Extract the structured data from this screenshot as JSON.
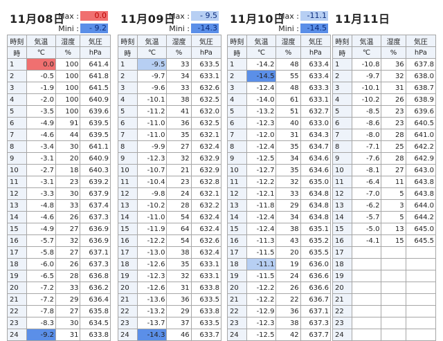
{
  "headers": {
    "row1": [
      "時刻",
      "気温",
      "湿度",
      "気圧"
    ],
    "row2": [
      "時",
      "℃",
      "%",
      "hPa"
    ]
  },
  "days": [
    {
      "date": "11月08日",
      "max_label": "Max :",
      "max": "0.0",
      "min_label": "Mini :",
      "min": "- 9.2",
      "rows": [
        [
          "1",
          "0.0",
          "100",
          "641.4"
        ],
        [
          "2",
          "-0.5",
          "100",
          "641.8"
        ],
        [
          "3",
          "-1.9",
          "100",
          "641.5"
        ],
        [
          "4",
          "-2.0",
          "100",
          "640.9"
        ],
        [
          "5",
          "-3.5",
          "100",
          "639.6"
        ],
        [
          "6",
          "-4.9",
          "91",
          "639.5"
        ],
        [
          "7",
          "-4.6",
          "44",
          "639.5"
        ],
        [
          "8",
          "-3.4",
          "30",
          "641.1"
        ],
        [
          "9",
          "-3.1",
          "20",
          "640.9"
        ],
        [
          "10",
          "-2.7",
          "18",
          "640.3"
        ],
        [
          "11",
          "-3.1",
          "23",
          "639.2"
        ],
        [
          "12",
          "-3.3",
          "30",
          "637.9"
        ],
        [
          "13",
          "-4.8",
          "33",
          "637.4"
        ],
        [
          "14",
          "-4.6",
          "26",
          "637.3"
        ],
        [
          "15",
          "-4.9",
          "27",
          "636.9"
        ],
        [
          "16",
          "-5.7",
          "32",
          "636.9"
        ],
        [
          "17",
          "-5.8",
          "27",
          "637.1"
        ],
        [
          "18",
          "-6.0",
          "26",
          "637.3"
        ],
        [
          "19",
          "-6.5",
          "28",
          "636.8"
        ],
        [
          "20",
          "-7.2",
          "33",
          "636.2"
        ],
        [
          "21",
          "-7.2",
          "29",
          "636.4"
        ],
        [
          "22",
          "-7.8",
          "27",
          "635.8"
        ],
        [
          "23",
          "-8.3",
          "30",
          "634.5"
        ],
        [
          "24",
          "-9.2",
          "31",
          "633.8"
        ]
      ]
    },
    {
      "date": "11月09日",
      "max_label": "Max :",
      "max": "- 9.5",
      "min_label": "Mini :",
      "min": "-14.3",
      "rows": [
        [
          "1",
          "-9.5",
          "33",
          "633.5"
        ],
        [
          "2",
          "-9.7",
          "34",
          "633.1"
        ],
        [
          "3",
          "-9.6",
          "33",
          "632.6"
        ],
        [
          "4",
          "-10.1",
          "38",
          "632.5"
        ],
        [
          "5",
          "-11.2",
          "41",
          "632.0"
        ],
        [
          "6",
          "-11.0",
          "36",
          "632.5"
        ],
        [
          "7",
          "-11.0",
          "35",
          "632.1"
        ],
        [
          "8",
          "-9.9",
          "27",
          "632.4"
        ],
        [
          "9",
          "-12.3",
          "32",
          "632.9"
        ],
        [
          "10",
          "-10.7",
          "21",
          "632.9"
        ],
        [
          "11",
          "-10.4",
          "23",
          "632.8"
        ],
        [
          "12",
          "-9.8",
          "24",
          "632.1"
        ],
        [
          "13",
          "-10.2",
          "28",
          "632.2"
        ],
        [
          "14",
          "-11.0",
          "54",
          "632.4"
        ],
        [
          "15",
          "-11.9",
          "64",
          "632.4"
        ],
        [
          "16",
          "-12.2",
          "54",
          "632.6"
        ],
        [
          "17",
          "-13.0",
          "38",
          "632.4"
        ],
        [
          "18",
          "-12.6",
          "35",
          "633.1"
        ],
        [
          "19",
          "-12.3",
          "32",
          "633.1"
        ],
        [
          "20",
          "-12.6",
          "31",
          "633.8"
        ],
        [
          "21",
          "-13.6",
          "36",
          "633.5"
        ],
        [
          "22",
          "-13.2",
          "29",
          "633.8"
        ],
        [
          "23",
          "-13.7",
          "37",
          "633.5"
        ],
        [
          "24",
          "-14.3",
          "46",
          "633.7"
        ]
      ]
    },
    {
      "date": "11月10日",
      "max_label": "Max :",
      "max": "-11.1",
      "min_label": "Mini :",
      "min": "-14.5",
      "rows": [
        [
          "1",
          "-14.2",
          "48",
          "633.4"
        ],
        [
          "2",
          "-14.5",
          "55",
          "633.4"
        ],
        [
          "3",
          "-12.4",
          "48",
          "633.3"
        ],
        [
          "4",
          "-14.0",
          "61",
          "633.1"
        ],
        [
          "5",
          "-13.2",
          "51",
          "632.7"
        ],
        [
          "6",
          "-12.3",
          "40",
          "633.0"
        ],
        [
          "7",
          "-12.0",
          "31",
          "634.3"
        ],
        [
          "8",
          "-12.4",
          "35",
          "634.7"
        ],
        [
          "9",
          "-12.5",
          "34",
          "634.6"
        ],
        [
          "10",
          "-12.7",
          "35",
          "634.6"
        ],
        [
          "11",
          "-12.2",
          "32",
          "635.0"
        ],
        [
          "12",
          "-12.1",
          "33",
          "634.8"
        ],
        [
          "13",
          "-11.8",
          "29",
          "634.8"
        ],
        [
          "14",
          "-12.4",
          "34",
          "634.8"
        ],
        [
          "15",
          "-12.4",
          "38",
          "635.1"
        ],
        [
          "16",
          "-11.3",
          "43",
          "635.2"
        ],
        [
          "17",
          "-11.5",
          "20",
          "635.5"
        ],
        [
          "18",
          "-11.1",
          "19",
          "636.0"
        ],
        [
          "19",
          "-11.5",
          "24",
          "636.6"
        ],
        [
          "20",
          "-12.2",
          "26",
          "636.6"
        ],
        [
          "21",
          "-12.2",
          "22",
          "636.7"
        ],
        [
          "22",
          "-12.9",
          "36",
          "637.1"
        ],
        [
          "23",
          "-12.3",
          "38",
          "637.3"
        ],
        [
          "24",
          "-12.5",
          "42",
          "637.7"
        ]
      ]
    },
    {
      "date": "11月11日",
      "rows": [
        [
          "1",
          "-10.8",
          "36",
          "637.8"
        ],
        [
          "2",
          "-9.7",
          "32",
          "638.0"
        ],
        [
          "3",
          "-10.1",
          "31",
          "638.7"
        ],
        [
          "4",
          "-10.2",
          "26",
          "638.9"
        ],
        [
          "5",
          "-8.5",
          "23",
          "639.6"
        ],
        [
          "6",
          "-8.6",
          "23",
          "640.5"
        ],
        [
          "7",
          "-8.0",
          "28",
          "641.0"
        ],
        [
          "8",
          "-7.1",
          "25",
          "642.2"
        ],
        [
          "9",
          "-7.6",
          "28",
          "642.9"
        ],
        [
          "10",
          "-8.1",
          "27",
          "643.0"
        ],
        [
          "11",
          "-6.4",
          "11",
          "643.8"
        ],
        [
          "12",
          "-7.0",
          "5",
          "643.8"
        ],
        [
          "13",
          "-6.2",
          "3",
          "644.0"
        ],
        [
          "14",
          "-5.7",
          "5",
          "644.2"
        ],
        [
          "15",
          "-5.0",
          "13",
          "645.0"
        ],
        [
          "16",
          "-4.1",
          "15",
          "645.5"
        ],
        [
          "17",
          "",
          "",
          ""
        ],
        [
          "18",
          "",
          "",
          ""
        ],
        [
          "19",
          "",
          "",
          ""
        ],
        [
          "20",
          "",
          "",
          ""
        ],
        [
          "21",
          "",
          "",
          ""
        ],
        [
          "22",
          "",
          "",
          ""
        ],
        [
          "23",
          "",
          "",
          ""
        ],
        [
          "24",
          "",
          "",
          ""
        ]
      ]
    }
  ],
  "colors": {
    "max_highlight": "#f07070",
    "min_highlight": "#5b8fe8",
    "light_highlight": "#b7cff3",
    "header_bg": "#eef3fa"
  }
}
